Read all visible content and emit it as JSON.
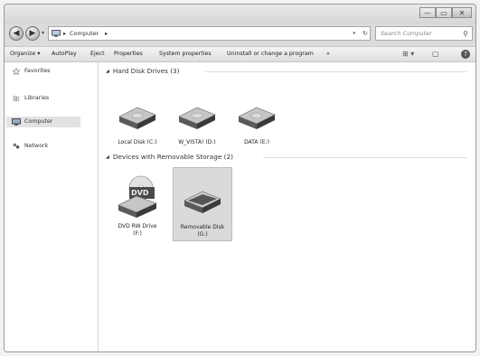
{
  "window": {
    "controls": {
      "minimize": "—",
      "maximize": "▭",
      "close": "✕"
    }
  },
  "address": {
    "back_icon": "back-arrow-icon",
    "forward_icon": "forward-arrow-icon",
    "dropdown": "▾",
    "sep1": "▸",
    "crumb": "Computer",
    "sep2": "▸",
    "address_dropdown": "▾",
    "refresh": "↻"
  },
  "search": {
    "placeholder": "Search Computer",
    "icon": "⚲"
  },
  "toolbar": {
    "organize": "Organize ▾",
    "autoplay": "AutoPlay",
    "eject": "Eject",
    "properties": "Properties",
    "system_properties": "System properties",
    "uninstall": "Uninstall or change a program",
    "more": "»",
    "view": "⊞ ▾",
    "preview": "▢",
    "help": "?"
  },
  "nav": {
    "favorites": "Favorites",
    "libraries": "Libraries",
    "computer": "Computer",
    "network": "Network"
  },
  "groups": {
    "hard": {
      "label": "Hard Disk Drives (3)"
    },
    "removable": {
      "label": "Devices with Removable Storage (2)"
    }
  },
  "drives": {
    "local": "Local Disk (C:)",
    "vista": "W_VISTA! (D:)",
    "data": "DATA (E:)",
    "dvd_line1": "DVD RW Drive",
    "dvd_line2": "(F:)",
    "dvd_badge": "DVD",
    "removable_line1": "Removable Disk",
    "removable_line2": "(G:)"
  },
  "colors": {
    "selection": "#dadada",
    "window_frame": "#dcdcdc"
  }
}
